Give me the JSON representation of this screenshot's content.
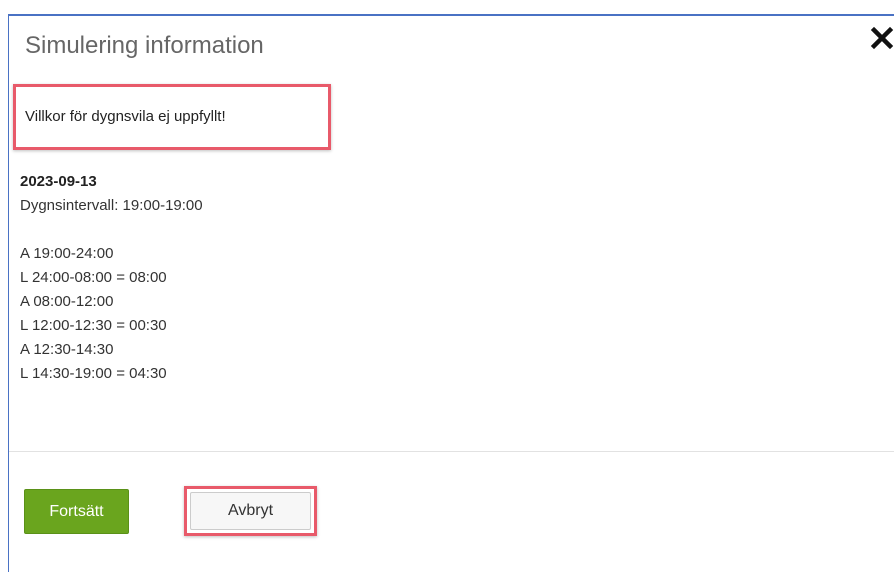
{
  "dialog": {
    "title": "Simulering information",
    "warning": "Villkor för dygnsvila ej uppfyllt!",
    "date": "2023-09-13",
    "interval": "Dygnsintervall: 19:00-19:00",
    "schedule": [
      "A 19:00-24:00",
      "L 24:00-08:00 = 08:00",
      "A 08:00-12:00",
      "L 12:00-12:30 = 00:30",
      "A 12:30-14:30",
      "L 14:30-19:00 = 04:30"
    ],
    "continue_label": "Fortsätt",
    "cancel_label": "Avbryt",
    "close_icon": "close-icon"
  },
  "colors": {
    "accent_border": "#4a72c4",
    "highlight": "#e85a6a",
    "continue_bg": "#6aa51e"
  }
}
